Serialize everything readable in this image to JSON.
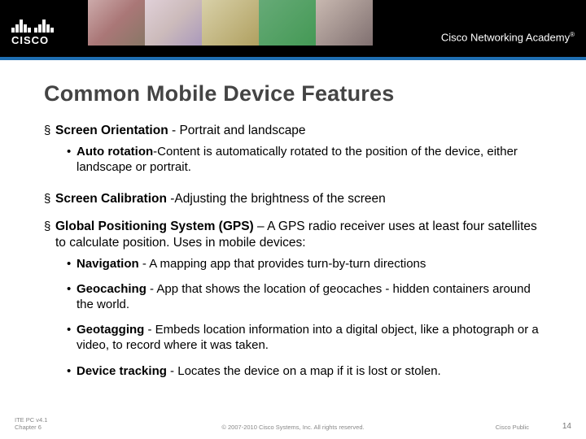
{
  "header": {
    "brand": "CISCO",
    "academy": "Cisco Networking Academy",
    "tm": "®"
  },
  "title": "Common Mobile Device Features",
  "bullets": [
    {
      "bold": "Screen Orientation ",
      "rest": " - Portrait and landscape",
      "subs": [
        {
          "bold": "Auto rotation",
          "rest": "-Content is automatically rotated to the position of the device, either landscape or portrait."
        }
      ]
    },
    {
      "bold": "Screen Calibration ",
      "rest": "-Adjusting the brightness of the screen",
      "subs": []
    },
    {
      "bold": "Global Positioning System (GPS) ",
      "rest": "– A GPS radio receiver uses at least four satellites to calculate position. Uses in mobile devices:",
      "subs": [
        {
          "bold": "Navigation",
          "rest": " - A mapping app that provides turn-by-turn directions"
        },
        {
          "bold": "Geocaching ",
          "rest": " - App that shows the location of geocaches - hidden containers around the world."
        },
        {
          "bold": "Geotagging",
          "rest": " - Embeds location information into a digital object, like a photograph or a video, to record where it was taken."
        },
        {
          "bold": "Device tracking",
          "rest": " - Locates the device on a map if it is lost or stolen."
        }
      ]
    }
  ],
  "footer": {
    "left1": "ITE PC v4.1",
    "left2": "Chapter 6",
    "copyright": "© 2007-2010 Cisco Systems, Inc. All rights reserved.",
    "right": "Cisco Public",
    "page": "14"
  }
}
